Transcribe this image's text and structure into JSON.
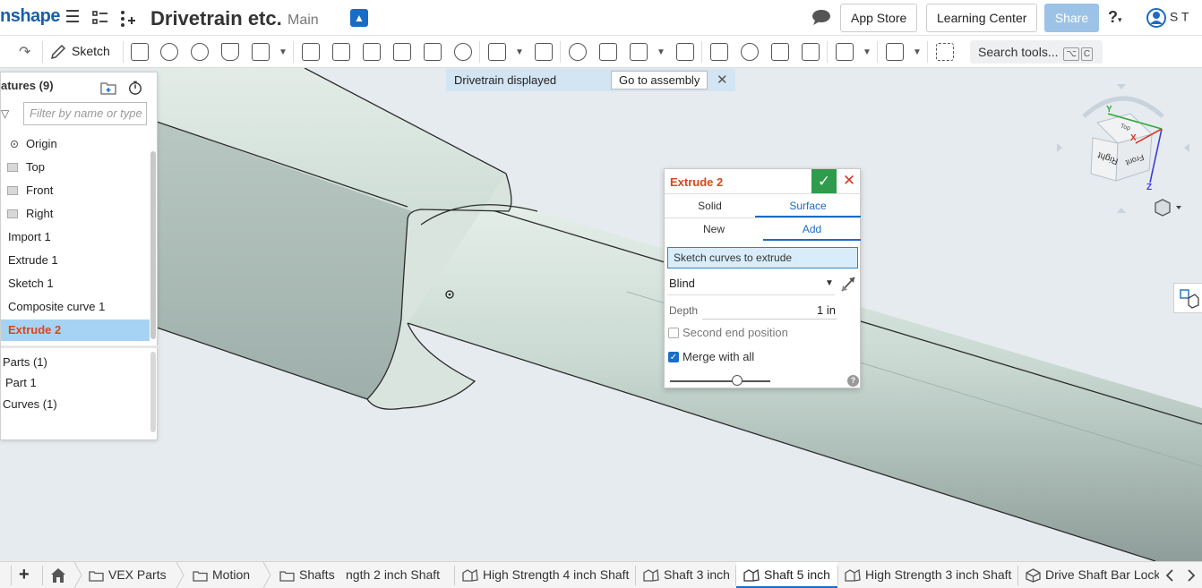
{
  "header": {
    "logo": "nshape",
    "document_title": "Drivetrain etc.",
    "branch": "Main",
    "app_store": "App Store",
    "learning_center": "Learning Center",
    "share": "Share",
    "help": "?",
    "user_initials": "S T"
  },
  "toolbar": {
    "sketch_label": "Sketch",
    "search_label": "Search tools...",
    "search_key1": "⌥",
    "search_key2": "C"
  },
  "notification": {
    "message": "Drivetrain displayed",
    "button": "Go to assembly"
  },
  "feature_tree": {
    "header": "atures (9)",
    "filter_placeholder": "Filter by name or type",
    "items": [
      {
        "label": "Origin",
        "kind": "origin"
      },
      {
        "label": "Top",
        "kind": "plane"
      },
      {
        "label": "Front",
        "kind": "plane"
      },
      {
        "label": "Right",
        "kind": "plane"
      },
      {
        "label": "Import 1",
        "kind": "feature"
      },
      {
        "label": "Extrude 1",
        "kind": "feature"
      },
      {
        "label": "Sketch 1",
        "kind": "feature"
      },
      {
        "label": "Composite curve 1",
        "kind": "feature"
      },
      {
        "label": "Extrude 2",
        "kind": "selected"
      }
    ],
    "parts_header": "Parts (1)",
    "part_1": "Part 1",
    "curves_header": "Curves (1)"
  },
  "extrude_dialog": {
    "title": "Extrude 2",
    "tab_solid": "Solid",
    "tab_surface": "Surface",
    "tab_new": "New",
    "tab_add": "Add",
    "selection_prompt": "Sketch curves to extrude",
    "end_type": "Blind",
    "depth_label": "Depth",
    "depth_value": "1 in",
    "second_end_label": "Second end position",
    "second_end_checked": false,
    "merge_label": "Merge with all",
    "merge_checked": true,
    "slider_fraction": 0.67
  },
  "view_cube": {
    "axis_x": "X",
    "axis_y": "Y",
    "axis_z": "Z",
    "face_right": "Right",
    "face_front": "Front",
    "face_top": "Top"
  },
  "tabs": {
    "add": "+",
    "breadcrumbs": [
      "VEX Parts",
      "Motion",
      "Shafts"
    ],
    "items": [
      {
        "label": "ngth 2 inch Shaft",
        "active": false
      },
      {
        "label": "High Strength 4 inch Shaft",
        "active": false
      },
      {
        "label": "Shaft 3 inch",
        "active": false
      },
      {
        "label": "Shaft 5 inch",
        "active": true
      },
      {
        "label": "High Strength 3 inch Shaft",
        "active": false
      },
      {
        "label": "Drive Shaft Bar Lock",
        "active": false
      }
    ]
  },
  "colors": {
    "brand_blue": "#1b6cc4",
    "accent_orange": "#d9471a",
    "confirm_green": "#2f9b4c",
    "cancel_red": "#d43a2b",
    "selected_row": "#a6d3f3",
    "shaft_face": "#c7d8d1"
  }
}
